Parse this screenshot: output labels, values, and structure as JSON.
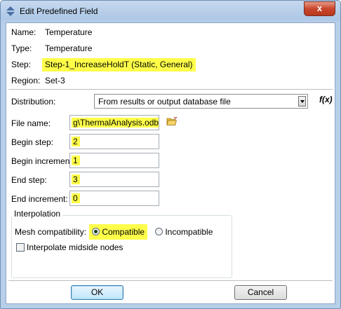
{
  "window": {
    "title": "Edit Predefined Field",
    "close_label": "x"
  },
  "info": {
    "name_label": "Name:",
    "name_value": "Temperature",
    "type_label": "Type:",
    "type_value": "Temperature",
    "step_label": "Step:",
    "step_value": "Step-1_IncreaseHoldT (Static, General)",
    "region_label": "Region:",
    "region_value": "Set-3"
  },
  "distribution": {
    "label": "Distribution:",
    "selected": "From results or output database file",
    "fx_label": "f(x)"
  },
  "fields": {
    "file_name_label": "File name:",
    "file_name_value": "g\\ThermalAnalysis.odb",
    "begin_step_label": "Begin step:",
    "begin_step_value": "2",
    "begin_increment_label": "Begin incremen",
    "begin_increment_value": "1",
    "end_step_label": "End step:",
    "end_step_value": "3",
    "end_increment_label": "End increment:",
    "end_increment_value": "0"
  },
  "interpolation": {
    "group_title": "Interpolation",
    "mesh_label": "Mesh compatibility:",
    "option_compatible": "Compatible",
    "option_incompatible": "Incompatible",
    "selected": "Compatible",
    "midside_label": "Interpolate midside nodes",
    "midside_checked": false
  },
  "buttons": {
    "ok": "OK",
    "cancel": "Cancel"
  },
  "colors": {
    "highlight": "#ffff4a",
    "close_button": "#c9462c"
  }
}
